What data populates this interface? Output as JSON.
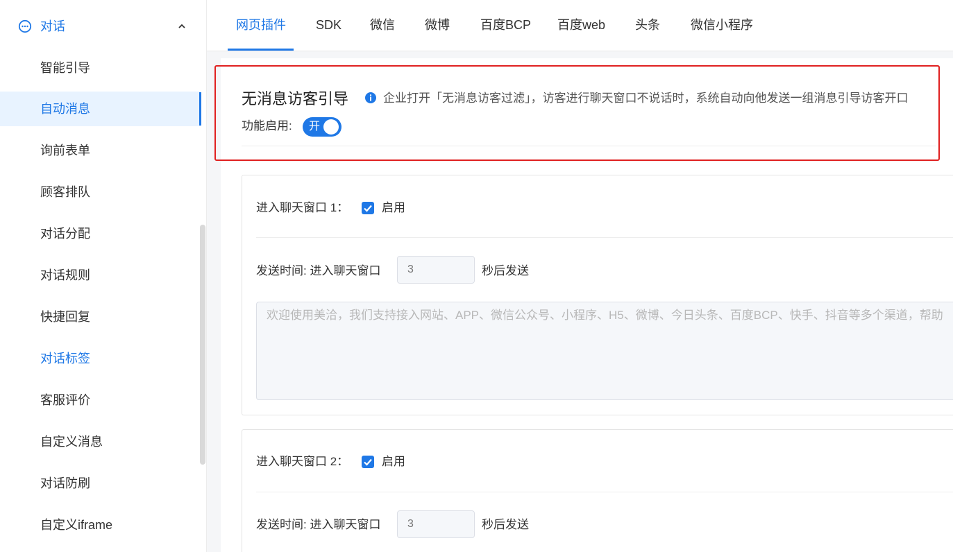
{
  "sidebar": {
    "title": "对话",
    "items": [
      {
        "label": "智能引导"
      },
      {
        "label": "自动消息"
      },
      {
        "label": "询前表单"
      },
      {
        "label": "顾客排队"
      },
      {
        "label": "对话分配"
      },
      {
        "label": "对话规则"
      },
      {
        "label": "快捷回复"
      },
      {
        "label": "对话标签"
      },
      {
        "label": "客服评价"
      },
      {
        "label": "自定义消息"
      },
      {
        "label": "对话防刷"
      },
      {
        "label": "自定义iframe"
      }
    ],
    "active_item": "自动消息"
  },
  "tabs": [
    {
      "label": "网页插件"
    },
    {
      "label": "SDK"
    },
    {
      "label": "微信"
    },
    {
      "label": "微博"
    },
    {
      "label": "百度BCP"
    },
    {
      "label": "百度web"
    },
    {
      "label": "头条"
    },
    {
      "label": "微信小程序"
    }
  ],
  "section": {
    "title": "无消息访客引导",
    "info": "企业打开「无消息访客过滤」，访客进行聊天窗口不说话时，系统自动向他发送一组消息引导访客开口",
    "enable_label": "功能启用:",
    "switch_label": "开"
  },
  "cards": [
    {
      "label": "进入聊天窗口 1：",
      "checkbox_label": "启用",
      "send_time_label": "发送时间: 进入聊天窗口",
      "delay_placeholder": "3",
      "after_label": "秒后发送",
      "message_placeholder": "欢迎使用美洽，我们支持接入网站、APP、微信公众号、小程序、H5、微博、今日头条、百度BCP、快手、抖音等多个渠道，帮助"
    },
    {
      "label": "进入聊天窗口 2：",
      "checkbox_label": "启用",
      "send_time_label": "发送时间: 进入聊天窗口",
      "delay_placeholder": "3",
      "after_label": "秒后发送"
    }
  ],
  "colors": {
    "accent": "#1f78e6",
    "highlight_border": "#e02020"
  }
}
